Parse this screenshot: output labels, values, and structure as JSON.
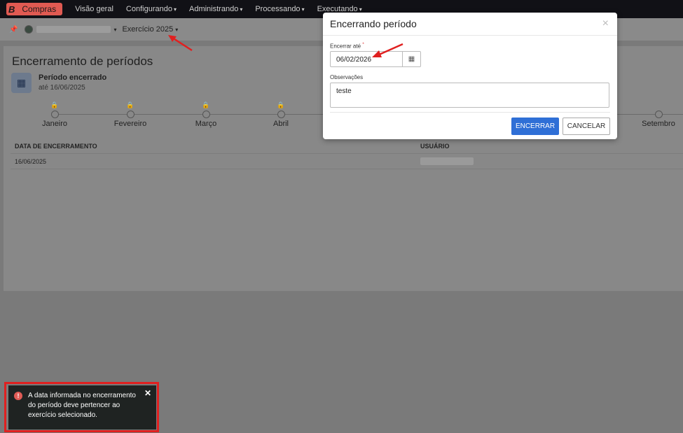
{
  "nav": {
    "logo_letter": "B",
    "app_name": "Compras",
    "items": [
      {
        "label": "Visão geral",
        "has_dropdown": false
      },
      {
        "label": "Configurando",
        "has_dropdown": true
      },
      {
        "label": "Administrando",
        "has_dropdown": true
      },
      {
        "label": "Processando",
        "has_dropdown": true
      },
      {
        "label": "Executando",
        "has_dropdown": true
      }
    ]
  },
  "subbar": {
    "exercise": "Exercício 2025"
  },
  "page": {
    "title": "Encerramento de períodos",
    "status_title": "Período encerrado",
    "status_subtitle": "até 16/06/2025",
    "months": [
      {
        "label": "Janeiro",
        "locked": true
      },
      {
        "label": "Fevereiro",
        "locked": true
      },
      {
        "label": "Março",
        "locked": true
      },
      {
        "label": "Abril",
        "locked": true
      },
      {
        "label": "Setembro",
        "locked": false
      }
    ],
    "table": {
      "headers": [
        "DATA DE ENCERRAMENTO",
        "USUÁRIO"
      ],
      "rows": [
        {
          "date": "16/06/2025"
        }
      ]
    }
  },
  "modal": {
    "title": "Encerrando período",
    "close_symbol": "×",
    "date_label": "Encerrar até",
    "required_mark": "*",
    "date_value": "06/02/2026",
    "obs_label": "Observações",
    "obs_value": "teste",
    "confirm_label": "ENCERRAR",
    "cancel_label": "CANCELAR"
  },
  "toast": {
    "message": "A data informada no encerramento do período deve pertencer ao exercício selecionado.",
    "icon_symbol": "!",
    "close_symbol": "✕"
  },
  "colors": {
    "nav_bg": "#111116",
    "brand": "#e05a52",
    "primary_button": "#2f6fd6",
    "annotation": "#e02020",
    "toast_bg": "#1f2322"
  }
}
